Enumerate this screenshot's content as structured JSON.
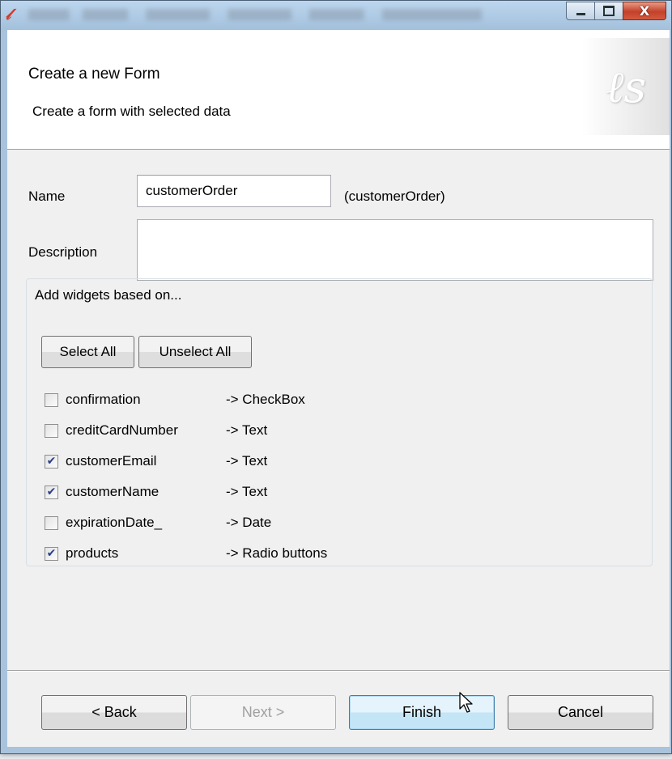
{
  "window": {
    "controls": {
      "minimize_icon": "minimize-icon",
      "maximize_icon": "maximize-icon",
      "close_icon": "close-icon",
      "close_glyph": "X"
    }
  },
  "header": {
    "title": "Create a new Form",
    "subtitle": "Create a form with selected data",
    "logo_icon": "bonita-logo-icon"
  },
  "form": {
    "name_label": "Name",
    "name_value": "customerOrder",
    "name_hint": "(customerOrder)",
    "description_label": "Description",
    "description_value": ""
  },
  "widgets": {
    "group_label": "Add widgets based on...",
    "select_all_label": "Select All",
    "unselect_all_label": "Unselect All",
    "items": [
      {
        "name": "confirmation",
        "type": "-> CheckBox",
        "checked": false
      },
      {
        "name": "creditCardNumber",
        "type": "-> Text",
        "checked": false
      },
      {
        "name": "customerEmail",
        "type": "-> Text",
        "checked": true
      },
      {
        "name": "customerName",
        "type": "-> Text",
        "checked": true
      },
      {
        "name": "expirationDate_",
        "type": "-> Date",
        "checked": false
      },
      {
        "name": "products",
        "type": "-> Radio buttons",
        "checked": true
      }
    ]
  },
  "buttons": {
    "back": "< Back",
    "next": "Next >",
    "finish": "Finish",
    "cancel": "Cancel"
  },
  "colors": {
    "title_bar": "#a9c3dd",
    "default_button": "#c4e5f6",
    "close_button": "#c2412a"
  }
}
